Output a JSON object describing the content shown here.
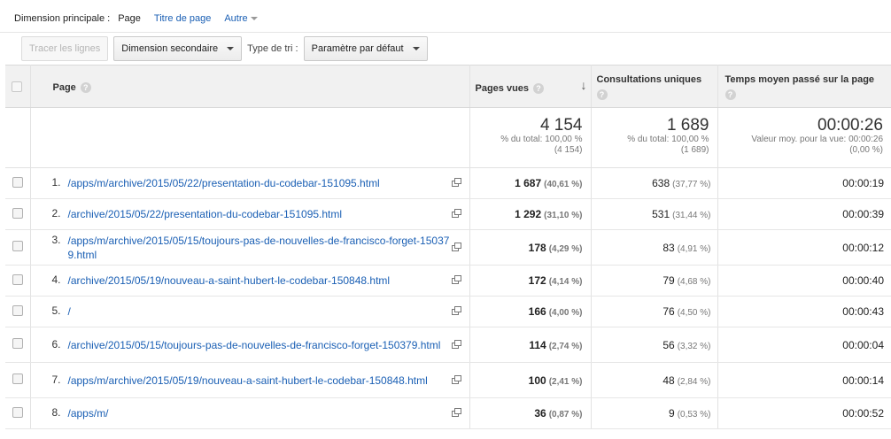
{
  "dimension_bar": {
    "label": "Dimension principale :",
    "current": "Page",
    "alt1": "Titre de page",
    "alt2": "Autre"
  },
  "toolbar": {
    "plot_rows": "Tracer les lignes",
    "secondary_dimension": "Dimension secondaire",
    "sort_label": "Type de tri :",
    "sort_value": "Paramètre par défaut"
  },
  "table": {
    "headers": {
      "page": "Page",
      "pageviews": "Pages vues",
      "unique": "Consultations uniques",
      "avg_time": "Temps moyen passé sur la page"
    },
    "totals": {
      "pageviews": "4 154",
      "pageviews_sub1": "% du total: 100,00 %",
      "pageviews_sub2": "(4 154)",
      "unique": "1 689",
      "unique_sub1": "% du total: 100,00 %",
      "unique_sub2": "(1 689)",
      "avg_time": "00:00:26",
      "avg_time_sub1": "Valeur moy. pour la vue: 00:00:26",
      "avg_time_sub2": "(0,00 %)"
    },
    "rows": [
      {
        "idx": "1.",
        "url": "/apps/m/archive/2015/05/22/presentation-du-codebar-151095.html",
        "pv": "1 687",
        "pv_pct": "(40,61 %)",
        "cu": "638",
        "cu_pct": "(37,77 %)",
        "tm": "00:00:19"
      },
      {
        "idx": "2.",
        "url": "/archive/2015/05/22/presentation-du-codebar-151095.html",
        "pv": "1 292",
        "pv_pct": "(31,10 %)",
        "cu": "531",
        "cu_pct": "(31,44 %)",
        "tm": "00:00:39"
      },
      {
        "idx": "3.",
        "url": "/apps/m/archive/2015/05/15/toujours-pas-de-nouvelles-de-francisco-forget-150379.html",
        "pv": "178",
        "pv_pct": "(4,29 %)",
        "cu": "83",
        "cu_pct": "(4,91 %)",
        "tm": "00:00:12"
      },
      {
        "idx": "4.",
        "url": "/archive/2015/05/19/nouveau-a-saint-hubert-le-codebar-150848.html",
        "pv": "172",
        "pv_pct": "(4,14 %)",
        "cu": "79",
        "cu_pct": "(4,68 %)",
        "tm": "00:00:40"
      },
      {
        "idx": "5.",
        "url": "/",
        "pv": "166",
        "pv_pct": "(4,00 %)",
        "cu": "76",
        "cu_pct": "(4,50 %)",
        "tm": "00:00:43"
      },
      {
        "idx": "6.",
        "url": "/archive/2015/05/15/toujours-pas-de-nouvelles-de-francisco-forget-150379.html",
        "pv": "114",
        "pv_pct": "(2,74 %)",
        "cu": "56",
        "cu_pct": "(3,32 %)",
        "tm": "00:00:04"
      },
      {
        "idx": "7.",
        "url": "/apps/m/archive/2015/05/19/nouveau-a-saint-hubert-le-codebar-150848.html",
        "pv": "100",
        "pv_pct": "(2,41 %)",
        "cu": "48",
        "cu_pct": "(2,84 %)",
        "tm": "00:00:14"
      },
      {
        "idx": "8.",
        "url": "/apps/m/",
        "pv": "36",
        "pv_pct": "(0,87 %)",
        "cu": "9",
        "cu_pct": "(0,53 %)",
        "tm": "00:00:52"
      }
    ]
  },
  "icons": {
    "help": "question-mark-icon",
    "sort": "sort-desc-arrow-icon",
    "open_page": "external-window-icon",
    "dropdown": "chevron-down-icon"
  },
  "colors": {
    "link": "#1a5fb4",
    "header_bg": "#f1f1f1"
  }
}
